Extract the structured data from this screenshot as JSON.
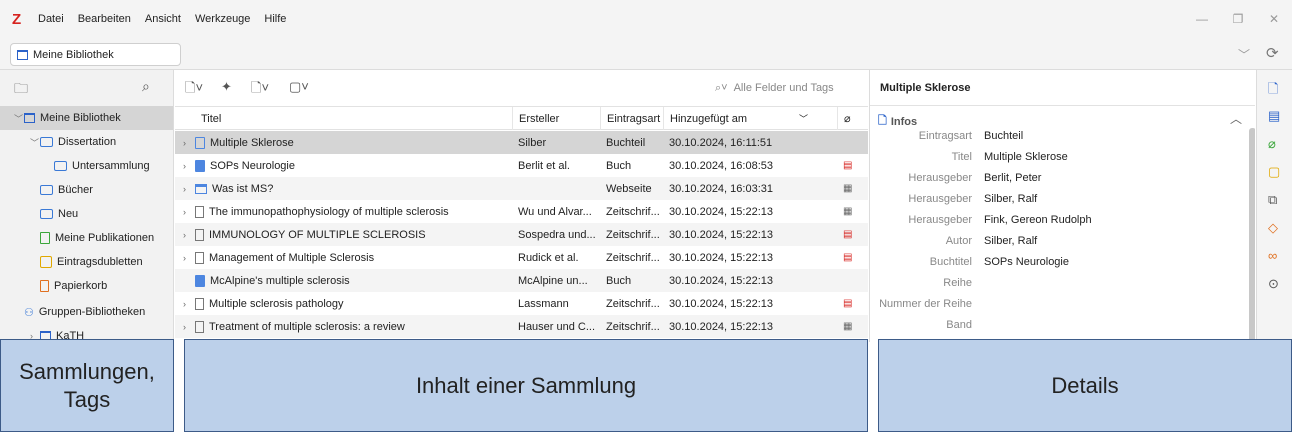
{
  "menubar": {
    "logo": "Z",
    "items": [
      "Datei",
      "Bearbeiten",
      "Ansicht",
      "Werkzeuge",
      "Hilfe"
    ],
    "window_controls": [
      "—",
      "❐",
      "✕"
    ]
  },
  "tabbar": {
    "library_tab": "Meine Bibliothek"
  },
  "collections": {
    "items": [
      {
        "label": "Meine Bibliothek",
        "selected": true,
        "level": 0,
        "icon": "library-icon",
        "twisty": "v"
      },
      {
        "label": "Dissertation",
        "level": 1,
        "icon": "folder-icon",
        "twisty": "v"
      },
      {
        "label": "Untersammlung",
        "level": 2,
        "icon": "folder-icon"
      },
      {
        "label": "Bücher",
        "level": 1,
        "icon": "saved-search-icon"
      },
      {
        "label": "Neu",
        "level": 1,
        "icon": "saved-search-icon"
      },
      {
        "label": "Meine Publikationen",
        "level": 1,
        "icon": "publications-icon"
      },
      {
        "label": "Eintragsdubletten",
        "level": 1,
        "icon": "duplicates-icon"
      },
      {
        "label": "Papierkorb",
        "level": 1,
        "icon": "trash-icon"
      },
      {
        "label": "Gruppen-Bibliotheken",
        "level": 0,
        "icon": "group-icon"
      },
      {
        "label": "KaTH",
        "level": 1,
        "icon": "library-icon",
        "twisty": ">"
      }
    ]
  },
  "items_toolbar": {
    "search_placeholder": "Alle Felder und Tags"
  },
  "columns": {
    "title": "Titel",
    "creator": "Ersteller",
    "item_type": "Eintragsart",
    "date_added": "Hinzugefügt am"
  },
  "items": [
    {
      "title": "Multiple Sklerose",
      "creator": "Silber",
      "type": "Buchteil",
      "date": "30.10.2024, 16:11:51",
      "icon": "book-section",
      "expand": true,
      "attachment": "",
      "selected": true
    },
    {
      "title": "SOPs Neurologie",
      "creator": "Berlit et al.",
      "type": "Buch",
      "date": "30.10.2024, 16:08:53",
      "icon": "book",
      "expand": true,
      "attachment": "pdf"
    },
    {
      "title": "Was ist MS?",
      "creator": "",
      "type": "Webseite",
      "date": "30.10.2024, 16:03:31",
      "icon": "webpage",
      "expand": true,
      "attachment": "snapshot"
    },
    {
      "title": "The immunopathophysiology of multiple sclerosis",
      "creator": "Wu und Alvar...",
      "type": "Zeitschrif...",
      "date": "30.10.2024, 15:22:13",
      "icon": "article",
      "expand": true,
      "attachment": "snapshot"
    },
    {
      "title": "IMMUNOLOGY OF MULTIPLE SCLEROSIS",
      "creator": "Sospedra und...",
      "type": "Zeitschrif...",
      "date": "30.10.2024, 15:22:13",
      "icon": "article",
      "expand": true,
      "attachment": "pdf"
    },
    {
      "title": "Management of Multiple Sclerosis",
      "creator": "Rudick et al.",
      "type": "Zeitschrif...",
      "date": "30.10.2024, 15:22:13",
      "icon": "article",
      "expand": true,
      "attachment": "pdf"
    },
    {
      "title": "McAlpine's multiple sclerosis",
      "creator": "McAlpine un...",
      "type": "Buch",
      "date": "30.10.2024, 15:22:13",
      "icon": "book",
      "expand": false,
      "attachment": ""
    },
    {
      "title": "Multiple sclerosis pathology",
      "creator": "Lassmann",
      "type": "Zeitschrif...",
      "date": "30.10.2024, 15:22:13",
      "icon": "article",
      "expand": true,
      "attachment": "pdf"
    },
    {
      "title": "Treatment of multiple sclerosis: a review",
      "creator": "Hauser und C...",
      "type": "Zeitschrif...",
      "date": "30.10.2024, 15:22:13",
      "icon": "article",
      "expand": true,
      "attachment": "snapshot"
    }
  ],
  "details": {
    "title": "Multiple Sklerose",
    "section": "Infos",
    "fields": [
      {
        "label": "Eintragsart",
        "value": "Buchteil"
      },
      {
        "label": "Titel",
        "value": "Multiple Sklerose"
      },
      {
        "label": "Herausgeber",
        "value": "Berlit, Peter"
      },
      {
        "label": "Herausgeber",
        "value": "Silber, Ralf"
      },
      {
        "label": "Herausgeber",
        "value": "Fink, Gereon Rudolph"
      },
      {
        "label": "Autor",
        "value": "Silber, Ralf"
      },
      {
        "label": "Buchtitel",
        "value": "SOPs Neurologie"
      },
      {
        "label": "Reihe",
        "value": ""
      },
      {
        "label": "Nummer der Reihe",
        "value": ""
      },
      {
        "label": "Band",
        "value": ""
      }
    ]
  },
  "annotations": {
    "left": "Sammlungen, Tags",
    "middle": "Inhalt einer Sammlung",
    "right": "Details"
  },
  "colors": {
    "annotation_fill": "#bcd0ea",
    "annotation_border": "#3d5b88",
    "selection": "#d5d5d5",
    "accent_blue": "#2b62c9",
    "pdf_red": "#d6231f"
  }
}
